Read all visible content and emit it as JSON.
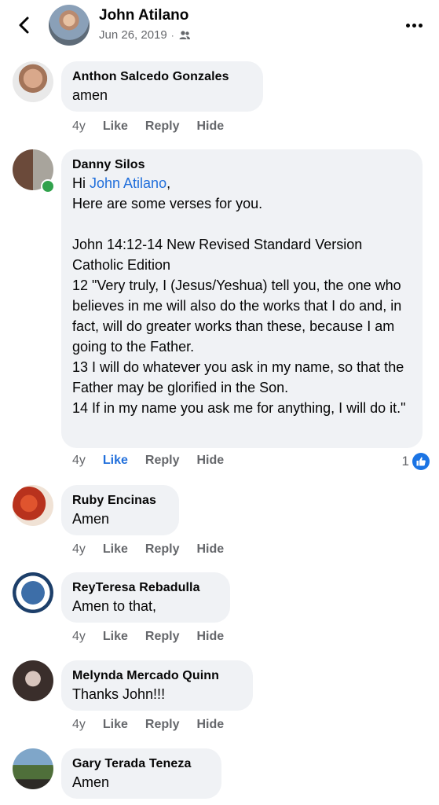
{
  "header": {
    "name": "John Atilano",
    "date": "Jun 26, 2019",
    "separator": "·",
    "audience_icon": "friends-icon",
    "back_icon": "chevron-left-icon",
    "more_icon": "more-horizontal-icon"
  },
  "comments": [
    {
      "author": "Anthon Salcedo Gonzales",
      "text": "amen",
      "time": "4y",
      "like": "Like",
      "reply": "Reply",
      "hide": "Hide"
    },
    {
      "author": "Danny Silos",
      "greeting": "Hi ",
      "mention": "John Atilano",
      "greeting_end": ",",
      "text": "Here are some verses for you.\n\nJohn 14:12-14 New Revised Standard Version Catholic Edition\n12 \"Very truly, I (Jesus/Yeshua) tell you, the one who believes in me will also do the works that I do and, in fact, will do greater works than these, because I am going to the Father.\n13 I will do whatever you ask in my name, so that the Father may be glorified in the Son.\n14 If in my name you ask me for anything, I will do it.\"",
      "time": "4y",
      "like": "Like",
      "reply": "Reply",
      "hide": "Hide",
      "reaction_count": "1",
      "online": true
    },
    {
      "author": "Ruby Encinas",
      "text": "Amen",
      "time": "4y",
      "like": "Like",
      "reply": "Reply",
      "hide": "Hide"
    },
    {
      "author": "ReyTeresa Rebadulla",
      "text": "Amen to that,",
      "time": "4y",
      "like": "Like",
      "reply": "Reply",
      "hide": "Hide"
    },
    {
      "author": "Melynda Mercado Quinn",
      "text": "Thanks John!!!",
      "time": "4y",
      "like": "Like",
      "reply": "Reply",
      "hide": "Hide"
    },
    {
      "author": "Gary Terada Teneza",
      "text": "Amen"
    }
  ],
  "colors": {
    "bubble": "#f0f2f5",
    "link_blue": "#216fdb",
    "meta_gray": "#65676b",
    "online_green": "#31a24c"
  }
}
